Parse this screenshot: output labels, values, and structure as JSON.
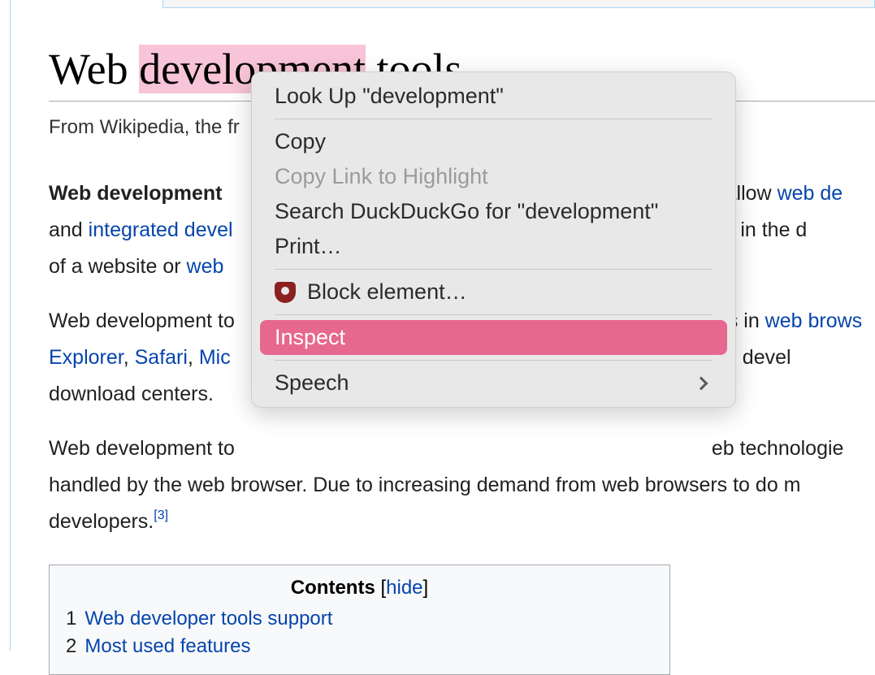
{
  "article": {
    "title_pre": "Web ",
    "title_highlight": "development",
    "title_post": " tools",
    "subtitle": "From Wikipedia, the fr",
    "para1": {
      "bold": "Web development ",
      "t1": "t) allow ",
      "link1": "web de",
      "t2": "and ",
      "link2": "integrated devel",
      "t3": " assist in the d",
      "t4": "of a website or ",
      "link3": "web "
    },
    "para2": {
      "t1": "Web development to",
      "t2": "s in ",
      "link1": "web brows",
      "link2": "Explorer",
      "sep1": ", ",
      "link3": "Safari",
      "sep2": ", ",
      "link4": "Mic",
      "t3": "elp web devel",
      "t4": "download centers."
    },
    "para3": {
      "t1": "Web development to",
      "t2": "eb technologie",
      "t3": "handled by the web browser. Due to increasing demand from web browsers to do m",
      "t4": "developers.",
      "ref": "[3]"
    },
    "toc": {
      "title": "Contents",
      "toggle": "hide",
      "items": [
        {
          "num": "1",
          "text": "Web developer tools support"
        },
        {
          "num": "2",
          "text": "Most used features"
        }
      ]
    }
  },
  "context_menu": {
    "lookup": "Look Up \"development\"",
    "copy": "Copy",
    "copy_link": "Copy Link to Highlight",
    "search": "Search DuckDuckGo for \"development\"",
    "print": "Print…",
    "block": "Block element…",
    "inspect": "Inspect",
    "speech": "Speech"
  }
}
